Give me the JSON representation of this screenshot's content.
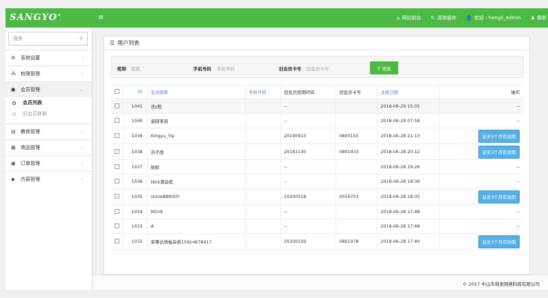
{
  "header": {
    "logo": "SANGYO",
    "logo_mark": "®",
    "menu_icon": "hamburger-icon",
    "site_front": "网站前台",
    "clear_cache": "清除缓存",
    "welcome": "欢迎 : hengli_admin",
    "switch": "换肤",
    "accent": "#4cb944"
  },
  "sidebar": {
    "search_placeholder": "搜索",
    "items": [
      {
        "label": "系统设置",
        "icon": "gear-icon"
      },
      {
        "label": "权限管理",
        "icon": "sitemap-icon"
      },
      {
        "label": "会员管理",
        "icon": "user-icon"
      },
      {
        "label": "教练管理",
        "icon": "coach-icon"
      },
      {
        "label": "商品管理",
        "icon": "goods-icon"
      },
      {
        "label": "订单管理",
        "icon": "order-icon"
      },
      {
        "label": "内容管理",
        "icon": "comment-icon"
      }
    ],
    "subitems": [
      {
        "label": "会员列表"
      },
      {
        "label": "旧会员数据"
      }
    ]
  },
  "panel": {
    "title": "用户列表",
    "filter": {
      "nick_label": "昵称",
      "nick_placeholder": "昵称",
      "phone_label": "手机号码",
      "phone_placeholder": "手机号码",
      "card_label": "旧会员卡号",
      "card_placeholder": "旧会员卡号",
      "button": "筛选"
    }
  },
  "table": {
    "headers": [
      "ID",
      "会员昵称",
      "手机号码",
      "旧会员到期时间",
      "旧会员卡号",
      "注册日期",
      "操作"
    ],
    "extend_label": "延长3个月有效期",
    "rows": [
      {
        "id": "1041",
        "nick": "洗z黠",
        "phone": "",
        "expire": "--",
        "card": "",
        "date": "2018-06-29 15:05",
        "op": "--"
      },
      {
        "id": "1040",
        "nick": "姿研美容",
        "phone": "",
        "expire": "--",
        "card": "",
        "date": "2018-06-29 07:58",
        "op": "--"
      },
      {
        "id": "1039",
        "nick": "Kingyu_Yip",
        "phone": "",
        "expire": "20190910",
        "card": "0800155",
        "date": "2018-06-28 21:13",
        "op": "btn"
      },
      {
        "id": "1038",
        "nick": "刘子胜",
        "phone": "",
        "expire": "20181130",
        "card": "0801933",
        "date": "2018-06-28 20:12",
        "op": "btn"
      },
      {
        "id": "1037",
        "nick": "鲜鲜",
        "phone": "",
        "expire": "--",
        "card": "",
        "date": "2018-06-28 19:26",
        "op": "--"
      },
      {
        "id": "1036",
        "nick": "Nick黄琼权",
        "phone": "",
        "expire": "--",
        "card": "",
        "date": "2018-06-28 18:06",
        "op": "--"
      },
      {
        "id": "1035",
        "nick": "stone889000",
        "phone": "",
        "expire": "20200518",
        "card": "0016703",
        "date": "2018-06-28 18:05",
        "op": "btn"
      },
      {
        "id": "1034",
        "nick": "M1n9",
        "phone": "",
        "expire": "--",
        "card": "",
        "date": "2018-06-28 17:48",
        "op": "--"
      },
      {
        "id": "1033",
        "nick": "A",
        "phone": "",
        "expire": "--",
        "card": "",
        "date": "2018-06-28 17:48",
        "op": "--"
      },
      {
        "id": "1032",
        "nick": "荣事达地板杂蒸15914678417",
        "phone": "",
        "expire": "20200109",
        "card": "0801978",
        "date": "2018-06-28 17:40",
        "op": "btn"
      }
    ]
  },
  "footer": {
    "copyright": "© 2017 中山市商发网络科技有限公司"
  }
}
